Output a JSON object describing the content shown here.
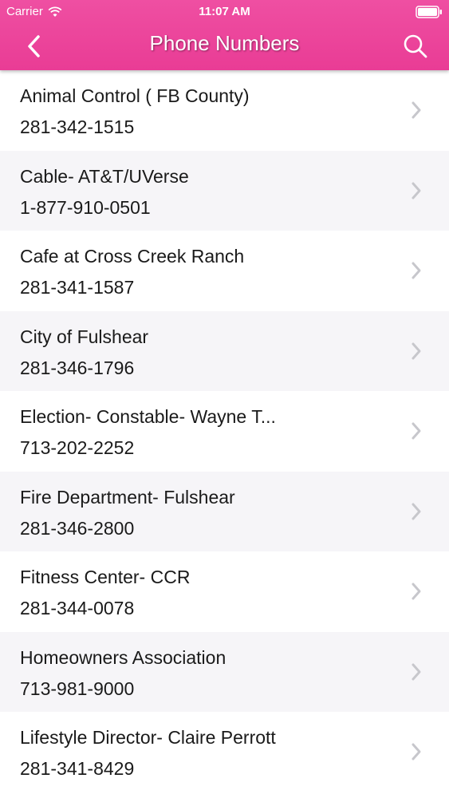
{
  "status_bar": {
    "carrier": "Carrier",
    "time": "11:07 AM"
  },
  "nav": {
    "title": "Phone Numbers"
  },
  "colors": {
    "header": "#ec4499",
    "row_alt": "#f6f5f8",
    "chevron": "#c7c7cc"
  },
  "contacts": [
    {
      "name": "Animal Control ( FB County)",
      "phone": "281-342-1515"
    },
    {
      "name": "Cable- AT&T/UVerse",
      "phone": "1-877-910-0501"
    },
    {
      "name": "Cafe at Cross Creek Ranch",
      "phone": "281-341-1587"
    },
    {
      "name": "City of Fulshear",
      "phone": "281-346-1796"
    },
    {
      "name": "Election- Constable- Wayne T...",
      "phone": "713-202-2252"
    },
    {
      "name": "Fire Department- Fulshear",
      "phone": "281-346-2800"
    },
    {
      "name": "Fitness Center- CCR",
      "phone": "281-344-0078"
    },
    {
      "name": "Homeowners Association",
      "phone": "713-981-9000"
    },
    {
      "name": "Lifestyle Director- Claire Perrott",
      "phone": "281-341-8429"
    }
  ]
}
